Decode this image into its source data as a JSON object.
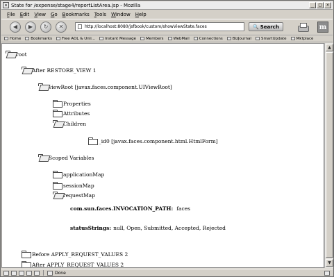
{
  "window": {
    "title": "State for /expense/stage4/reportListArea.jsp - Mozilla"
  },
  "menu": [
    "File",
    "Edit",
    "View",
    "Go",
    "Bookmarks",
    "Tools",
    "Window",
    "Help"
  ],
  "nav": {
    "url": "http://localhost:8080/jsfbook/custom/showViewState.faces",
    "search_label": "Search"
  },
  "bookmarks": [
    "Home",
    "Bookmarks",
    "Free AOL & Unli...",
    "Instant Message",
    "Members",
    "WebMail",
    "Connections",
    "BizJournal",
    "SmartUpdate",
    "Mktplace"
  ],
  "tree": {
    "root": "root",
    "after_restore": "After RESTORE_VIEW 1",
    "viewroot": "viewRoot [javax.faces.component.UIViewRoot]",
    "properties": "Properties",
    "attributes": "Attributes",
    "children": "Children",
    "id0": "_id0 [javax.faces.component.html.HtmlForm]",
    "scoped": "Scoped Variables",
    "application_map": "applicationMap",
    "session_map": "sessionMap",
    "request_map": "requestMap",
    "invocation_key": "com.sun.faces.INVOCATION_PATH:",
    "invocation_val": "faces",
    "status_key": "statusStrings:",
    "status_val": "null, Open, Submitted, Accepted, Rejected",
    "before_apply": "Before APPLY_REQUEST_VALUES 2",
    "after_apply": "After APPLY_REQUEST_VALUES 2"
  },
  "status": {
    "text": "Done"
  }
}
